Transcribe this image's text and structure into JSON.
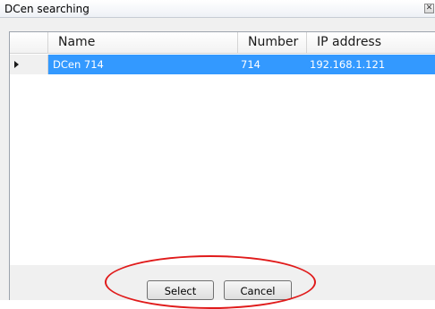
{
  "window": {
    "title": "DCen searching",
    "close_glyph": "✕"
  },
  "grid": {
    "columns": [
      "Name",
      "Number",
      "IP address"
    ],
    "rows": [
      {
        "name": "DCen 714",
        "number": "714",
        "ip": "192.168.1.121",
        "selected": true
      }
    ]
  },
  "buttons": {
    "select_label": "Select",
    "cancel_label": "Cancel"
  },
  "annotation": {
    "oval_color": "#e01b1b"
  },
  "colors": {
    "selection": "#3399ff",
    "selection_text": "#ffffff"
  }
}
